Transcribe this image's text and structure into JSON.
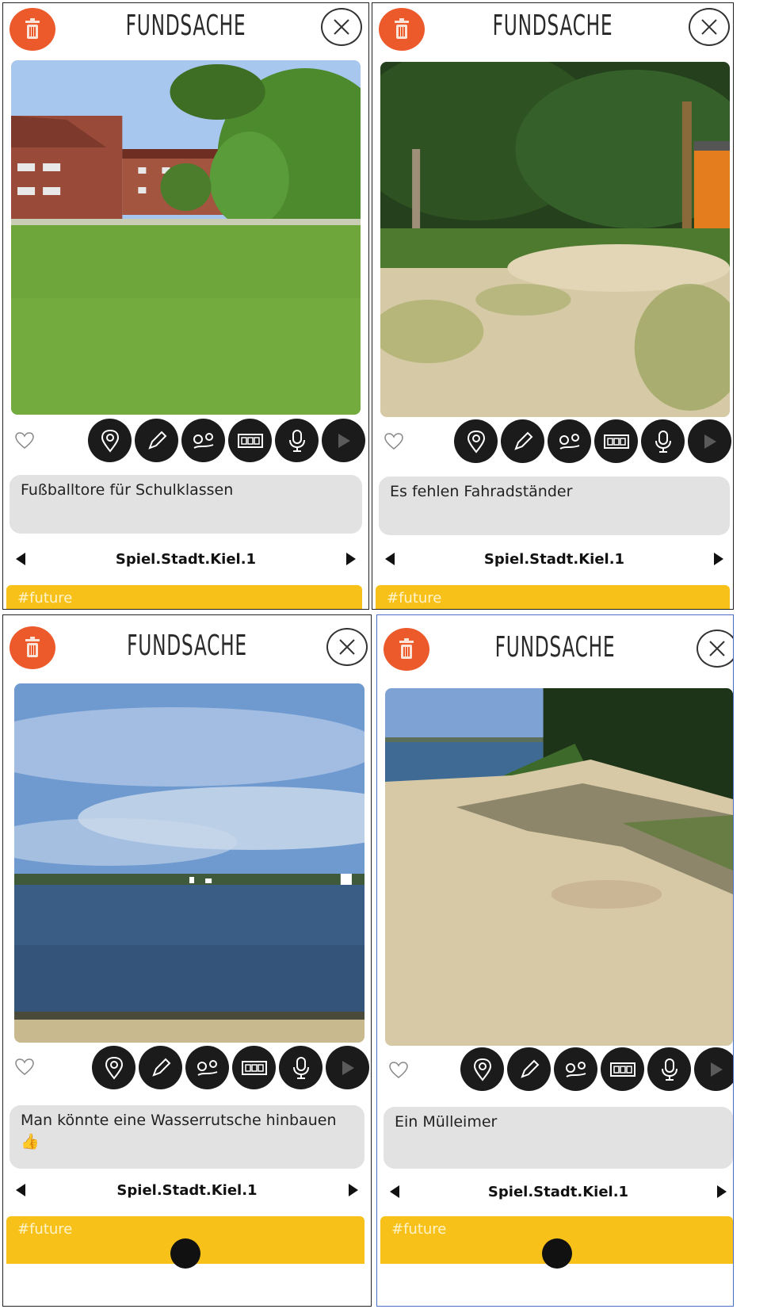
{
  "cards": [
    {
      "title": "FUNDSACHE",
      "description": "Fußballtore für Schulklassen",
      "collection": "Spiel.Stadt.Kiel.1",
      "tag": "#future",
      "photo": "park-lawn-photo"
    },
    {
      "title": "FUNDSACHE",
      "description": "Es fehlen Fahradständer",
      "collection": "Spiel.Stadt.Kiel.1",
      "tag": "#future",
      "photo": "sandy-path-photo"
    },
    {
      "title": "FUNDSACHE",
      "description": "Man könnte eine Wasserrutsche hinbauen 👍",
      "collection": "Spiel.Stadt.Kiel.1",
      "tag": "#future",
      "photo": "sea-view-photo"
    },
    {
      "title": "FUNDSACHE",
      "description": "Ein Mülleimer",
      "collection": "Spiel.Stadt.Kiel.1",
      "tag": "#future",
      "photo": "beach-photo"
    }
  ],
  "toolbar_icons": [
    "location-pin-icon",
    "pencil-icon",
    "route-icon",
    "film-strip-icon",
    "microphone-icon",
    "play-icon"
  ],
  "colors": {
    "accent_orange": "#ec5a2c",
    "tag_yellow": "#f8c11a",
    "button_dark": "#1b1b1b",
    "textbox_gray": "#e2e2e2"
  }
}
